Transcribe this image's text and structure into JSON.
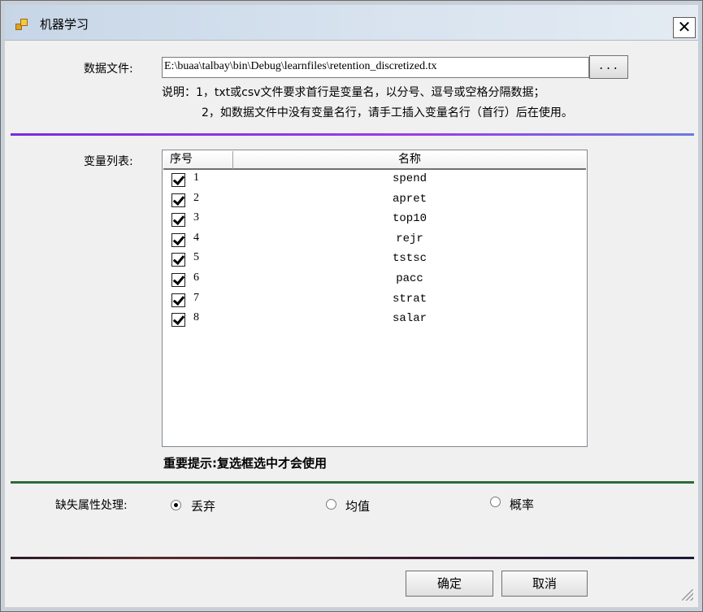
{
  "window": {
    "title": "机器学习",
    "close_symbol": "✕"
  },
  "file": {
    "label": "数据文件:",
    "path": "E:\\buaa\\talbay\\bin\\Debug\\learnfiles\\retention_discretized.tx",
    "browse_label": "..."
  },
  "notes": {
    "line1": "说明：1，txt或csv文件要求首行是变量名，以分号、逗号或空格分隔数据；",
    "line2": "2，如数据文件中没有变量名行，请手工插入变量名行（首行）后在使用。"
  },
  "variables": {
    "label": "变量列表:",
    "columns": [
      "序号",
      "名称"
    ],
    "rows": [
      {
        "no": "1",
        "name": "spend",
        "checked": true
      },
      {
        "no": "2",
        "name": "apret",
        "checked": true
      },
      {
        "no": "3",
        "name": "top10",
        "checked": true
      },
      {
        "no": "4",
        "name": "rejr",
        "checked": true
      },
      {
        "no": "5",
        "name": "tstsc",
        "checked": true
      },
      {
        "no": "6",
        "name": "pacc",
        "checked": true
      },
      {
        "no": "7",
        "name": "strat",
        "checked": true
      },
      {
        "no": "8",
        "name": "salar",
        "checked": true
      }
    ],
    "hint": "重要提示:复选框选中才会使用"
  },
  "missing": {
    "label": "缺失属性处理:",
    "options": [
      {
        "label": "丢弃",
        "selected": true
      },
      {
        "label": "均值",
        "selected": false
      },
      {
        "label": "概率",
        "selected": false
      }
    ]
  },
  "buttons": {
    "ok": "确定",
    "cancel": "取消"
  },
  "colors": {
    "divider_top": "#8a2be2",
    "divider_middle": "#2e6b3a",
    "divider_bottom": "#3a1830"
  },
  "icons": [
    "app-icon",
    "close-icon",
    "checkbox-checked",
    "radio-button",
    "resize-grip-icon"
  ]
}
